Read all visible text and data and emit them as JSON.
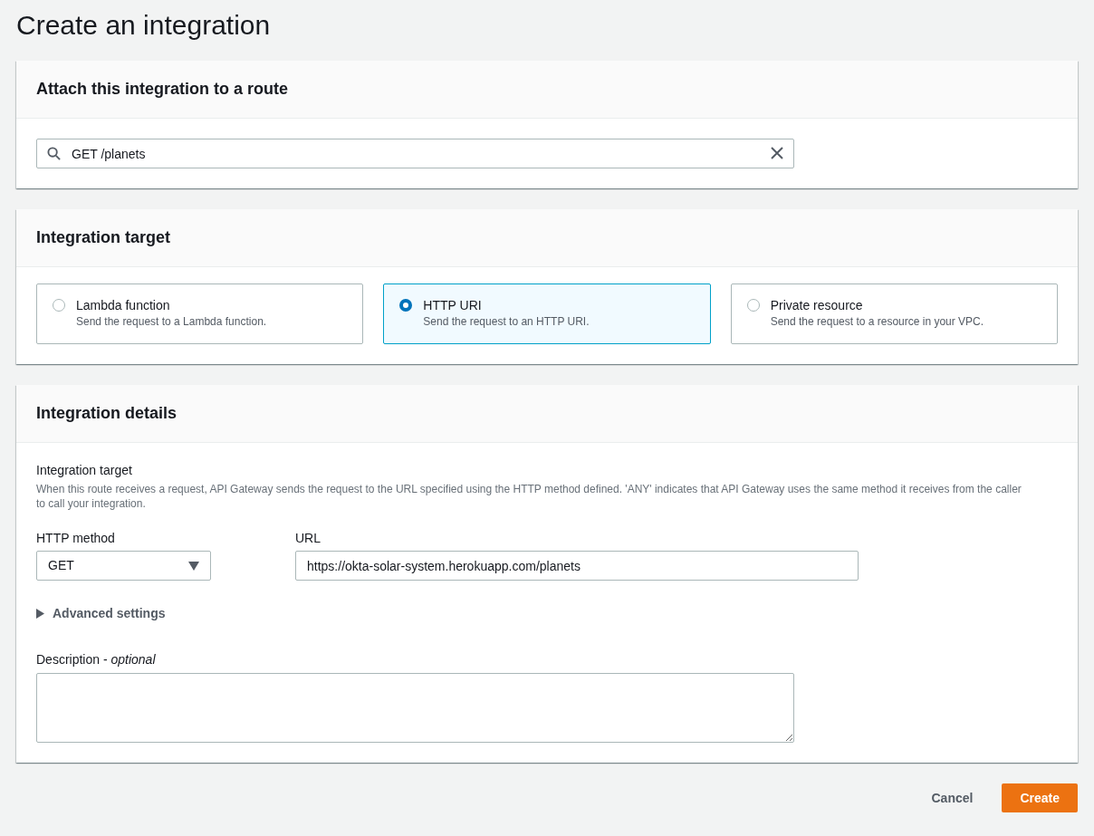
{
  "page_title": "Create an integration",
  "route_section": {
    "title": "Attach this integration to a route",
    "search": {
      "value": "GET /planets"
    }
  },
  "target_section": {
    "title": "Integration target",
    "options": [
      {
        "label": "Lambda function",
        "description": "Send the request to a Lambda function.",
        "selected": false
      },
      {
        "label": "HTTP URI",
        "description": "Send the request to an HTTP URI.",
        "selected": true
      },
      {
        "label": "Private resource",
        "description": "Send the request to a resource in your VPC.",
        "selected": false
      }
    ]
  },
  "details_section": {
    "title": "Integration details",
    "target_label": "Integration target",
    "target_help": "When this route receives a request, API Gateway sends the request to the URL specified using the HTTP method defined. 'ANY' indicates that API Gateway uses the same method it receives from the caller to call your integration.",
    "method": {
      "label": "HTTP method",
      "value": "GET"
    },
    "url": {
      "label": "URL",
      "value": "https://okta-solar-system.herokuapp.com/planets"
    },
    "advanced": {
      "label": "Advanced settings",
      "expanded": false
    },
    "description": {
      "label": "Description - *optional*"
    }
  },
  "buttons": [
    {
      "label": "Cancel",
      "kind": "link"
    },
    {
      "label": "Create",
      "kind": "primary"
    }
  ]
}
